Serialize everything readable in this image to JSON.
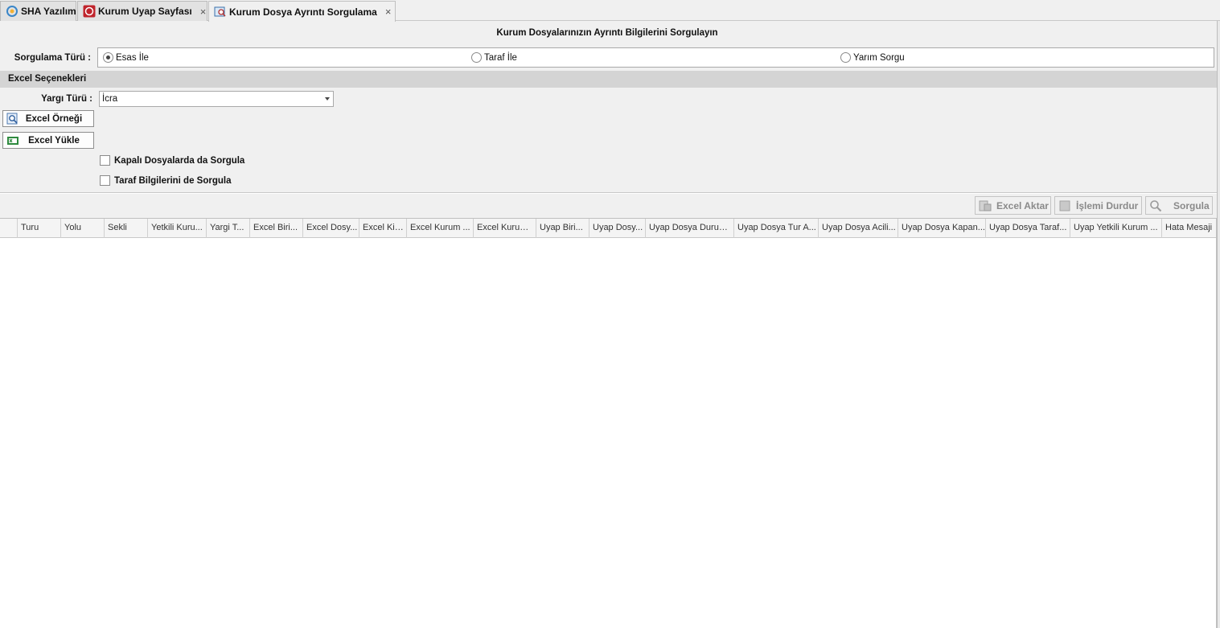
{
  "tabs": [
    {
      "label": "SHA Yazılım",
      "icon": "sha-logo-icon",
      "closable": false,
      "active": false
    },
    {
      "label": "Kurum Uyap Sayfası",
      "icon": "uyap-logo-icon",
      "closable": true,
      "active": false
    },
    {
      "label": "Kurum Dosya Ayrıntı Sorgulama",
      "icon": "document-search-icon",
      "closable": true,
      "active": true
    }
  ],
  "tab_close_glyph": "×",
  "page_title": "Kurum Dosyalarınızın Ayrıntı Bilgilerini Sorgulayın",
  "query_type": {
    "label": "Sorgulama Türü :",
    "options": [
      {
        "label": "Esas İle",
        "selected": true
      },
      {
        "label": "Taraf İle",
        "selected": false
      },
      {
        "label": "Yarım Sorgu",
        "selected": false
      }
    ]
  },
  "excel_section": {
    "title": "Excel Seçenekleri",
    "judgment_type_label": "Yargı Türü :",
    "judgment_type_value": "İcra",
    "sample_button": "Excel Örneği",
    "upload_button": "Excel Yükle",
    "check_closed_files": "Kapalı Dosyalarda da Sorgula",
    "check_party_info": "Taraf Bilgilerini de Sorgula"
  },
  "toolbar": {
    "export_label": "Excel Aktar",
    "stop_label": "İşlemi Durdur",
    "query_label": "Sorgula"
  },
  "grid": {
    "columns": [
      "",
      "Turu",
      "Yolu",
      "Sekli",
      "Yetkili Kuru...",
      "Yargi T...",
      "Excel Biri...",
      "Excel Dosy...",
      "Excel Kis...",
      "Excel Kurum ...",
      "Excel Kurum ...",
      "Uyap Biri...",
      "Uyap Dosy...",
      "Uyap Dosya Durum...",
      "Uyap Dosya Tur A...",
      "Uyap Dosya Acili...",
      "Uyap Dosya Kapan...",
      "Uyap Dosya Taraf...",
      "Uyap Yetkili Kurum ...",
      "Hata Mesaji"
    ]
  },
  "colors": {
    "section_bar": "#d4d4d4",
    "background": "#f0f0f0",
    "disabled_text": "#8a8a8a"
  }
}
